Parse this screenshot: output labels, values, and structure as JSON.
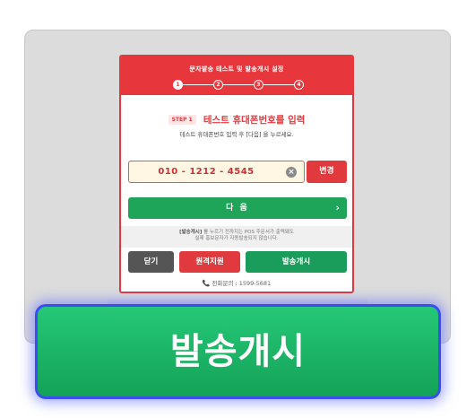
{
  "dialog": {
    "title": "문자발송 테스트 및 발송개시 설정",
    "steps": [
      "1",
      "2",
      "3",
      "4"
    ],
    "step_badge": "STEP 1",
    "step_heading": "테스트 휴대폰번호를 입력",
    "step_desc": "테스트 휴대폰번호 입력 후 [다음] 을 누르세요.",
    "phone_value": "010 - 1212 - 4545",
    "clear_symbol": "×",
    "change_label": "변경",
    "next_label": "다 음",
    "next_chevron": "›",
    "notice_strong": "[발송개시]",
    "notice_line1_rest": " 를 누르기 전까지는 POS 주문서가 출력돼도",
    "notice_line2": "실제 홍보문자가 자동발송되지 않습니다.",
    "buttons": {
      "close": "닫기",
      "remote": "원격지원",
      "start": "발송개시"
    },
    "contact": "전화문의 : 1599-5681",
    "contact_icon": "📞"
  },
  "callout": {
    "label": "발송개시"
  },
  "colors": {
    "brand_red": "#e8373c",
    "action_green": "#1ea55a",
    "highlight_border": "#3b4cf0"
  }
}
